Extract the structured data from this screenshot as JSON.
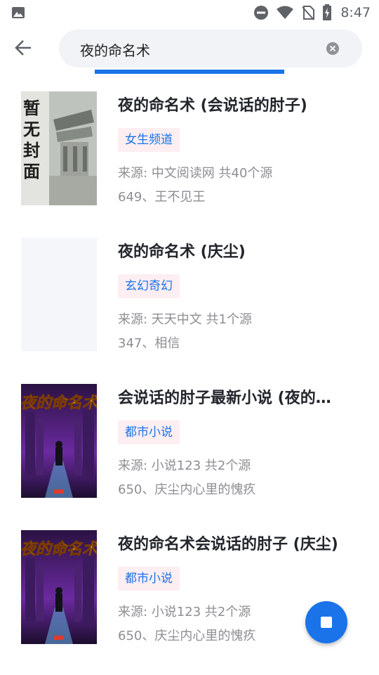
{
  "status_bar": {
    "time": "8:47",
    "icons": [
      "image-icon",
      "do-not-disturb-icon",
      "wifi-icon",
      "no-sim-icon",
      "battery-charging-icon"
    ]
  },
  "search": {
    "query": "夜的命名术",
    "back_icon": "arrow-back-icon",
    "clear_icon": "clear-circle-icon"
  },
  "results": [
    {
      "title": "夜的命名术 (会说话的肘子)",
      "tag": "女生频道",
      "source": "来源: 中文阅读网 共40个源",
      "latest": "649、王不见王",
      "cover": {
        "type": "placeholder",
        "text": [
          "暂",
          "无",
          "封",
          "面"
        ]
      }
    },
    {
      "title": "夜的命名术 (庆尘)",
      "tag": "玄幻奇幻",
      "source": "来源: 天天中文 共1个源",
      "latest": "347、相信",
      "cover": {
        "type": "empty"
      }
    },
    {
      "title": "会说话的肘子最新小说 (夜的…",
      "tag": "都市小说",
      "source": "来源: 小说123 共2个源",
      "latest": "650、庆尘内心里的愧疚",
      "cover": {
        "type": "art",
        "title": "夜的命名术"
      }
    },
    {
      "title": "夜的命名术会说话的肘子 (庆尘)",
      "tag": "都市小说",
      "source": "来源: 小说123 共2个源",
      "latest": "650、庆尘内心里的愧疚",
      "cover": {
        "type": "art",
        "title": "夜的命名术"
      }
    }
  ],
  "fab": {
    "icon": "stop-icon"
  },
  "colors": {
    "accent": "#1a73e8",
    "tag_bg": "#fdeef2",
    "muted_text": "#8e8e93",
    "search_bg": "#f1f3f6"
  }
}
